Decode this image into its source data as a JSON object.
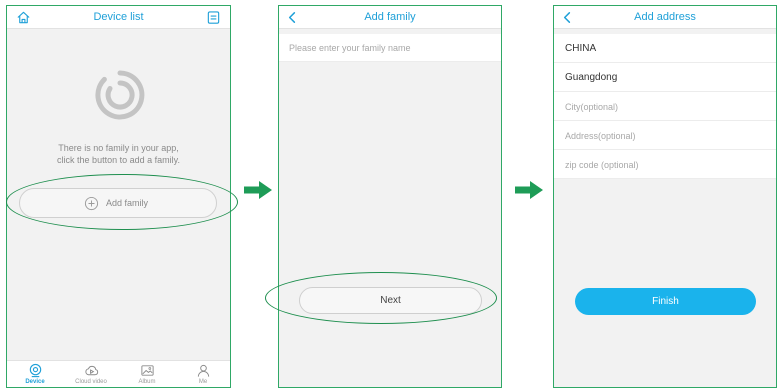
{
  "colors": {
    "accent": "#1fa0d8",
    "frame": "#2fa866",
    "finish": "#1ab3ec",
    "highlight": "#1f8f4f"
  },
  "screen1": {
    "title": "Device list",
    "left_icon": "home-icon",
    "right_icon": "list-menu-icon",
    "empty_text_line1": "There is no family in your app,",
    "empty_text_line2": "click the button to add a family.",
    "add_family_label": "Add family",
    "tabs": [
      {
        "label": "Device",
        "icon": "camera-icon",
        "active": true
      },
      {
        "label": "Cloud video",
        "icon": "cloud-play-icon",
        "active": false
      },
      {
        "label": "Album",
        "icon": "album-icon",
        "active": false
      },
      {
        "label": "Me",
        "icon": "user-icon",
        "active": false
      }
    ]
  },
  "screen2": {
    "title": "Add family",
    "family_name_placeholder": "Please enter your family name",
    "next_label": "Next"
  },
  "screen3": {
    "title": "Add address",
    "country": "CHINA",
    "province": "Guangdong",
    "city_placeholder": "City(optional)",
    "address_placeholder": "Address(optional)",
    "zip_placeholder": "zip code (optional)",
    "finish_label": "Finish"
  }
}
